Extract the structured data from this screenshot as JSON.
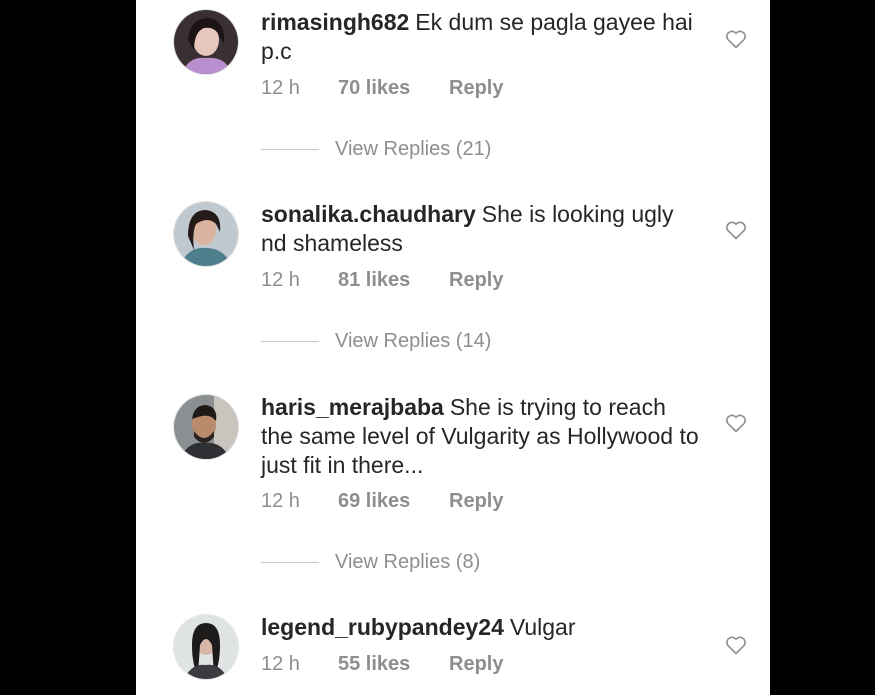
{
  "comments": [
    {
      "username": "rimasingh682",
      "text": "Ek dum se pagla gayee hai p.c",
      "time": "12 h",
      "likes": "70 likes",
      "reply_label": "Reply",
      "view_replies": "View Replies (21)"
    },
    {
      "username": "sonalika.chaudhary",
      "text": "She is looking ugly nd shameless",
      "time": "12 h",
      "likes": "81 likes",
      "reply_label": "Reply",
      "view_replies": "View Replies (14)"
    },
    {
      "username": "haris_merajbaba",
      "text": "She is trying to reach the same level of Vulgarity as Hollywood to just fit in there...",
      "time": "12 h",
      "likes": "69 likes",
      "reply_label": "Reply",
      "view_replies": "View Replies (8)"
    },
    {
      "username": "legend_rubypandey24",
      "text": "Vulgar",
      "time": "12 h",
      "likes": "55 likes",
      "reply_label": "Reply"
    }
  ],
  "icons": {
    "like": "heart-outline-icon",
    "avatar": "profile-photo"
  },
  "colors": {
    "text": "#262626",
    "secondary": "#8e8e8e",
    "background": "#ffffff",
    "frame": "#000000"
  }
}
